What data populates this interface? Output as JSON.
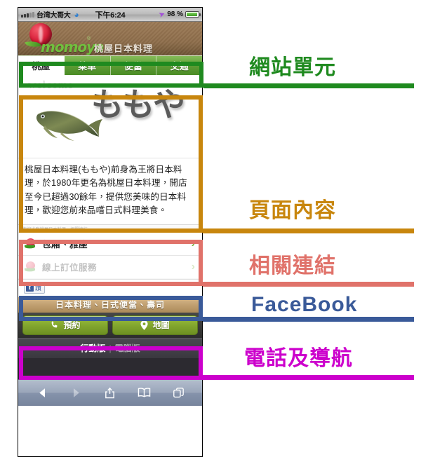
{
  "phone": {
    "statusbar": {
      "carrier": "台湾大哥大",
      "wifi_icon": "wifi-icon",
      "time": "下午6:24",
      "location_icon": "location-arrow-icon",
      "battery_percent": "98 %"
    },
    "site_header": {
      "logo_word": "momoya",
      "logo_registered": "®",
      "logo_cn": "桃屋日本料理"
    },
    "nav": {
      "tabs": [
        {
          "label": "桃屋",
          "active": true
        },
        {
          "label": "菜單",
          "active": false
        },
        {
          "label": "便當",
          "active": false
        },
        {
          "label": "交通",
          "active": false
        }
      ]
    },
    "hero": {
      "welcome": "welcome",
      "kanji": "ももや",
      "image_name": "carp-fish-photo"
    },
    "intro": "桃屋日本料理(ももや)前身為王將日本料理，於1980年更名為桃屋日本料理，開店至今已超過30餘年，提供您美味的日本料理，歡迎您前來品嚐日式料理美食。",
    "links": {
      "header_faint": "歡迎光臨桃屋日本料理．相關連結",
      "items": [
        {
          "label": "包廂、雅座",
          "chevron": "›"
        },
        {
          "label": "線上訂位服務",
          "chevron": "›"
        }
      ]
    },
    "facebook": {
      "like_label": "讚",
      "f_glyph": "f"
    },
    "tagline": "日本料理、日式便當、壽司",
    "actions": [
      {
        "label": "預約",
        "icon": "phone-icon"
      },
      {
        "label": "地圖",
        "icon": "map-pin-icon"
      }
    ],
    "footer": {
      "current": "行動版",
      "separator": "|",
      "other": "電腦版"
    },
    "safari_toolbar": [
      {
        "icon": "back-arrow-icon",
        "enabled": true
      },
      {
        "icon": "forward-arrow-icon",
        "enabled": false
      },
      {
        "icon": "share-icon",
        "enabled": true
      },
      {
        "icon": "bookmarks-icon",
        "enabled": true
      },
      {
        "icon": "tabs-icon",
        "enabled": true
      }
    ]
  },
  "annotations": [
    {
      "label": "網站單元",
      "color": "#1f8a1f"
    },
    {
      "label": "頁面內容",
      "color": "#c8860d"
    },
    {
      "label": "相關連結",
      "color": "#e0726a"
    },
    {
      "label": "FaceBook",
      "color": "#3a5a99"
    },
    {
      "label": "電話及導航",
      "color": "#cc00cc"
    }
  ]
}
